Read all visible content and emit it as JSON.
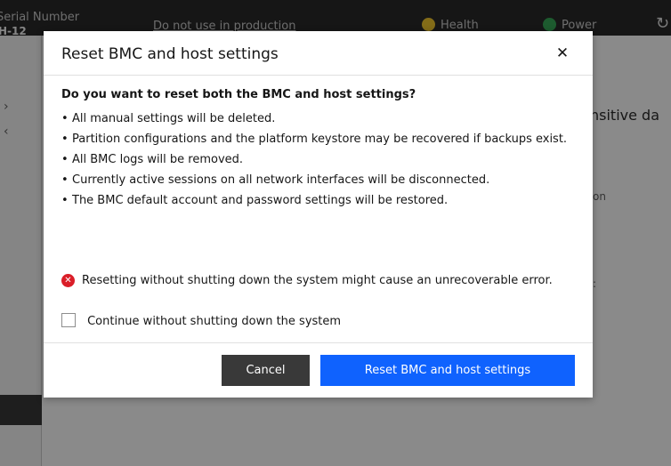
{
  "background": {
    "serial_label": "Serial Number",
    "serial_value": "H-12",
    "production_warning": "Do not use in production",
    "health_label": "Health",
    "power_label": "Power",
    "partial_text_1": "nsitive da",
    "partial_text_2": "on",
    "partial_text_3": ":"
  },
  "modal": {
    "title": "Reset BMC and host settings",
    "question": "Do you want to reset both the BMC and host settings?",
    "bullets": [
      "All manual settings will be deleted.",
      "Partition configurations and the platform keystore may be recovered if backups exist.",
      "All BMC logs will be removed.",
      "Currently active sessions on all network interfaces will be disconnected.",
      "The BMC default account and password settings will be restored."
    ],
    "error_text": "Resetting without shutting down the system might cause an unrecoverable error.",
    "checkbox_label": "Continue without shutting down the system",
    "checkbox_checked": false,
    "cancel_label": "Cancel",
    "confirm_label": "Reset BMC and host settings"
  },
  "colors": {
    "primary": "#0f62fe",
    "secondary_button": "#393939",
    "error": "#da1e28",
    "health_warning": "#f1c21b",
    "power_ok": "#24a148"
  },
  "icons": {
    "close": "close-icon",
    "error": "error-icon",
    "refresh": "refresh-icon"
  }
}
